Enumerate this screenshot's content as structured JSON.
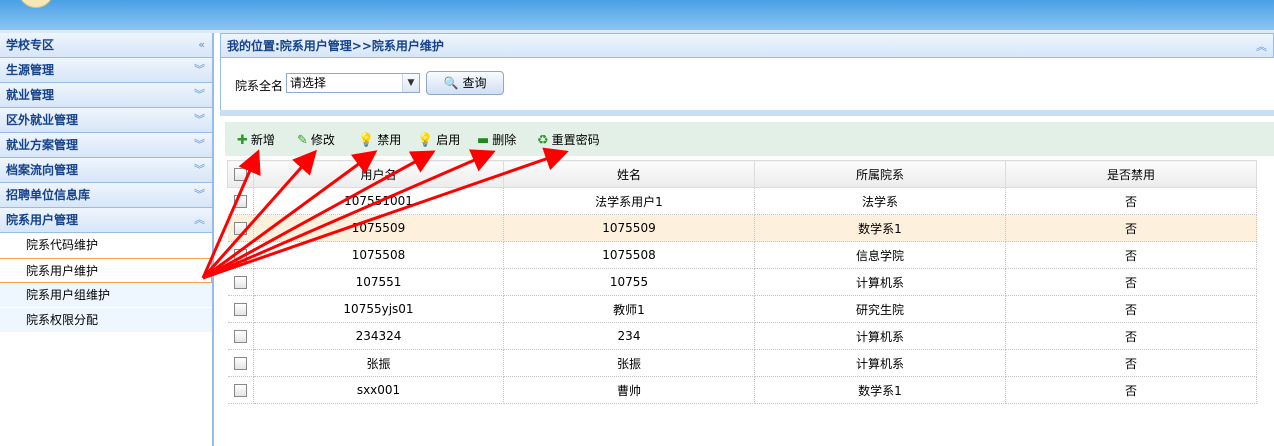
{
  "sidebar": {
    "header": "学校专区",
    "sections": [
      "生源管理",
      "就业管理",
      "区外就业管理",
      "就业方案管理",
      "档案流向管理",
      "招聘单位信息库",
      "院系用户管理"
    ],
    "sub_items": [
      "院系代码维护",
      "院系用户维护",
      "院系用户组维护",
      "院系权限分配"
    ]
  },
  "breadcrumb": "我的位置:院系用户管理>>院系用户维护",
  "search": {
    "label": "院系全名",
    "select_value": "请选择",
    "button": "查询"
  },
  "toolbar": {
    "add": "新增",
    "edit": "修改",
    "disable": "禁用",
    "enable": "启用",
    "delete": "删除",
    "reset_pwd": "重置密码"
  },
  "table": {
    "columns": [
      "用户名",
      "姓名",
      "所属院系",
      "是否禁用"
    ],
    "rows": [
      [
        "107551001",
        "法学系用户1",
        "法学系",
        "否"
      ],
      [
        "1075509",
        "1075509",
        "数学系1",
        "否"
      ],
      [
        "1075508",
        "1075508",
        "信息学院",
        "否"
      ],
      [
        "107551",
        "10755",
        "计算机系",
        "否"
      ],
      [
        "10755yjs01",
        "教师1",
        "研究生院",
        "否"
      ],
      [
        "234324",
        "234",
        "计算机系",
        "否"
      ],
      [
        "张振",
        "张振",
        "计算机系",
        "否"
      ],
      [
        "sxx001",
        "曹帅",
        "数学系1",
        "否"
      ]
    ]
  },
  "colors": {
    "accent_blue": "#15428b",
    "annotation_arrow": "#ff0000",
    "highlight_row": "#fdf0dc"
  }
}
